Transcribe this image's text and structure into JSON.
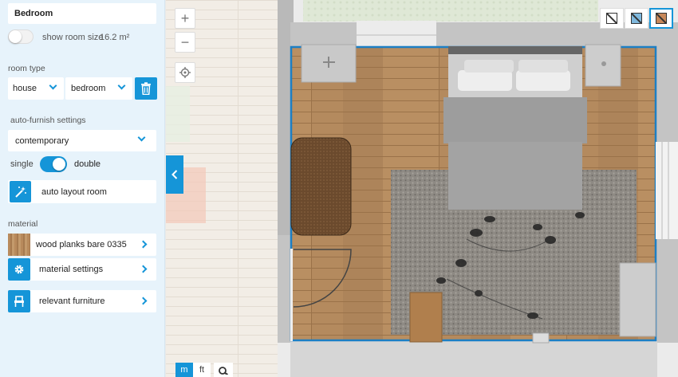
{
  "room": {
    "name": "Bedroom",
    "show_size_label": "show room size",
    "size": "16.2 m²"
  },
  "room_type": {
    "label": "room type",
    "category": "house",
    "type": "bedroom"
  },
  "auto_furnish": {
    "label": "auto-furnish settings",
    "style": "contemporary",
    "bed_single": "single",
    "bed_double": "double",
    "auto_layout_label": "auto layout room"
  },
  "material": {
    "label": "material",
    "name": "wood planks bare 0335",
    "settings_label": "material settings",
    "furniture_label": "relevant furniture"
  },
  "units": {
    "metric": "m",
    "imperial": "ft"
  },
  "zoom": {
    "in": "+",
    "out": "−"
  },
  "colors": {
    "accent": "#1595d8",
    "sidebar_bg": "#e7f3fb",
    "floor_wood": "#b48a5e",
    "room_outline": "#1d7fc4"
  },
  "icons": {
    "delete": "trash-icon",
    "wand": "magic-wand-icon",
    "settings": "gear-icon",
    "furniture": "chair-icon",
    "locate": "crosshair-icon",
    "search": "magnifier-icon"
  }
}
